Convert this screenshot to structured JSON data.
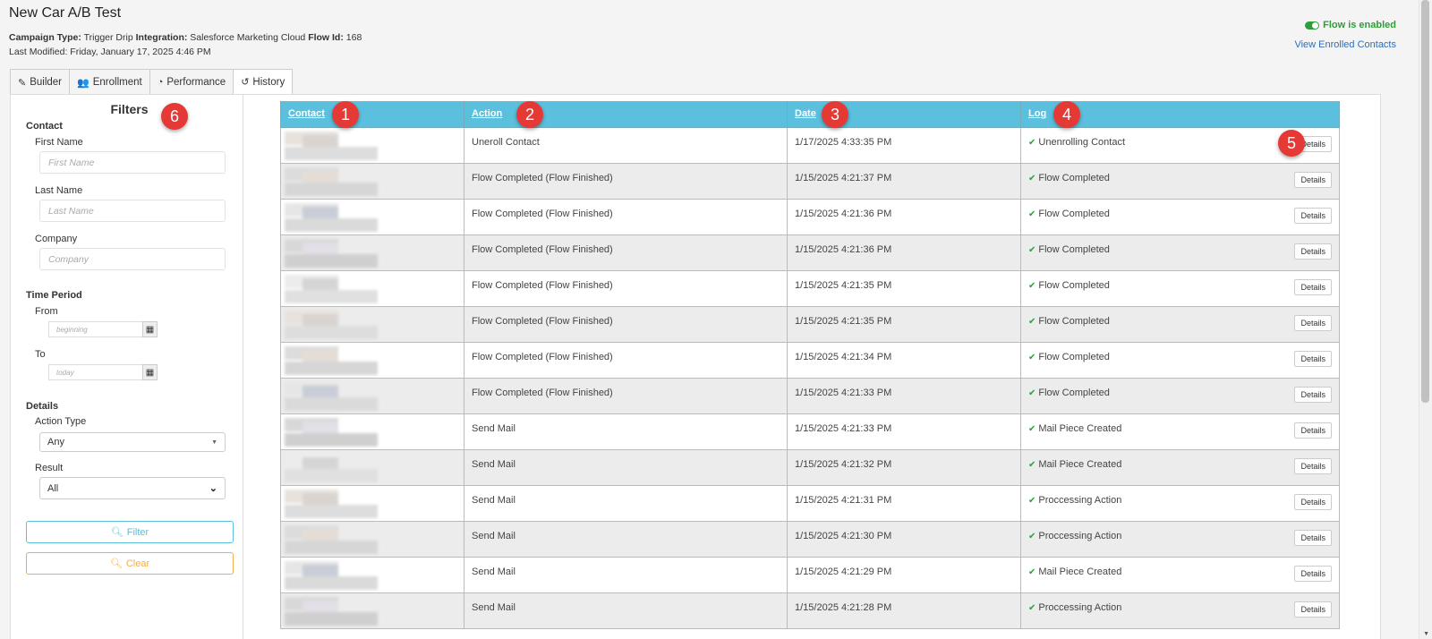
{
  "header": {
    "title": "New Car A/B Test",
    "campaign_type_label": "Campaign Type:",
    "campaign_type": "Trigger Drip",
    "integration_label": "Integration:",
    "integration": "Salesforce Marketing Cloud",
    "flow_id_label": "Flow Id:",
    "flow_id": "168",
    "last_modified": "Last Modified: Friday, January 17, 2025 4:46 PM",
    "flow_status": "Flow is enabled",
    "enrolled_link": "View Enrolled Contacts"
  },
  "tabs": [
    {
      "label": "Builder",
      "icon": "edit-icon"
    },
    {
      "label": "Enrollment",
      "icon": "users-icon"
    },
    {
      "label": "Performance",
      "icon": "dashboard-icon"
    },
    {
      "label": "History",
      "icon": "history-icon",
      "active": true
    }
  ],
  "filters": {
    "title": "Filters",
    "contact_section": "Contact",
    "first_name_label": "First Name",
    "first_name_placeholder": "First Name",
    "last_name_label": "Last Name",
    "last_name_placeholder": "Last Name",
    "company_label": "Company",
    "company_placeholder": "Company",
    "time_section": "Time Period",
    "from_label": "From",
    "from_placeholder": "beginning",
    "to_label": "To",
    "to_placeholder": "today",
    "details_section": "Details",
    "action_type_label": "Action Type",
    "action_type_value": "Any",
    "result_label": "Result",
    "result_value": "All",
    "filter_button": "Filter",
    "clear_button": "Clear"
  },
  "table": {
    "columns": [
      "Contact",
      "Action",
      "Date",
      "Log"
    ],
    "details_label": "Details",
    "rows": [
      {
        "action": "Uneroll Contact",
        "date": "1/17/2025 4:33:35 PM",
        "log": "Unenrolling Contact"
      },
      {
        "action": "Flow Completed (Flow Finished)",
        "date": "1/15/2025 4:21:37 PM",
        "log": "Flow Completed"
      },
      {
        "action": "Flow Completed (Flow Finished)",
        "date": "1/15/2025 4:21:36 PM",
        "log": "Flow Completed"
      },
      {
        "action": "Flow Completed (Flow Finished)",
        "date": "1/15/2025 4:21:36 PM",
        "log": "Flow Completed"
      },
      {
        "action": "Flow Completed (Flow Finished)",
        "date": "1/15/2025 4:21:35 PM",
        "log": "Flow Completed"
      },
      {
        "action": "Flow Completed (Flow Finished)",
        "date": "1/15/2025 4:21:35 PM",
        "log": "Flow Completed"
      },
      {
        "action": "Flow Completed (Flow Finished)",
        "date": "1/15/2025 4:21:34 PM",
        "log": "Flow Completed"
      },
      {
        "action": "Flow Completed (Flow Finished)",
        "date": "1/15/2025 4:21:33 PM",
        "log": "Flow Completed"
      },
      {
        "action": "Send Mail",
        "date": "1/15/2025 4:21:33 PM",
        "log": "Mail Piece Created"
      },
      {
        "action": "Send Mail",
        "date": "1/15/2025 4:21:32 PM",
        "log": "Mail Piece Created"
      },
      {
        "action": "Send Mail",
        "date": "1/15/2025 4:21:31 PM",
        "log": "Proccessing Action"
      },
      {
        "action": "Send Mail",
        "date": "1/15/2025 4:21:30 PM",
        "log": "Proccessing Action"
      },
      {
        "action": "Send Mail",
        "date": "1/15/2025 4:21:29 PM",
        "log": "Mail Piece Created"
      },
      {
        "action": "Send Mail",
        "date": "1/15/2025 4:21:28 PM",
        "log": "Proccessing Action"
      }
    ]
  },
  "annotations": [
    "1",
    "2",
    "3",
    "4",
    "5",
    "6"
  ],
  "colors": {
    "header_accent": "#5bc0de",
    "success": "#2e9d3a",
    "annotation": "#e53935",
    "clear_button": "#f0ad4e",
    "link": "#2a6ebb"
  }
}
